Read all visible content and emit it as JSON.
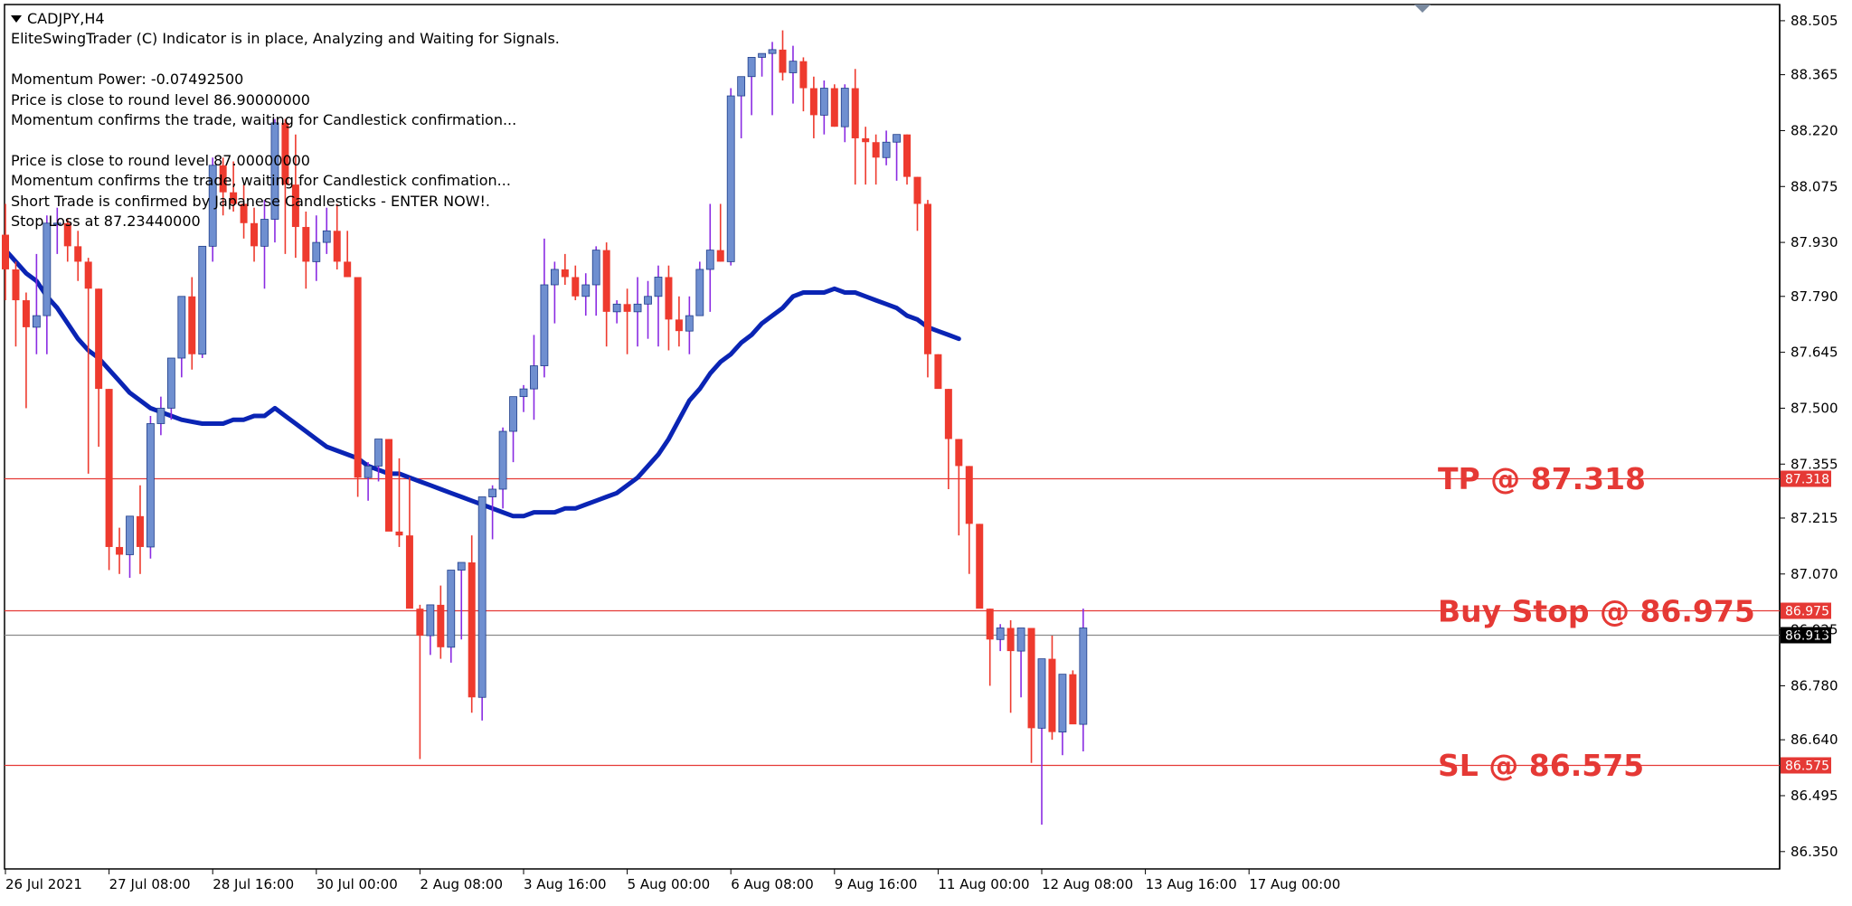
{
  "header": {
    "symbol": "CADJPY,H4",
    "lines": [
      "EliteSwingTrader (C) Indicator is in place, Analyzing and Waiting for Signals.",
      "",
      "Momentum Power: -0.07492500",
      "Price is close to round level 86.90000000",
      "Momentum confirms the trade, waiting for Candlestick confirmation...",
      "",
      "Price is close to round level 87.00000000",
      "Momentum confirms the trade, waiting for Candlestick confimation...",
      "Short Trade is confirmed by Japanese Candlesticks - ENTER NOW!.",
      "Stop Loss at 87.23440000"
    ]
  },
  "chart_data": {
    "type": "candlestick",
    "ylim": [
      86.305,
      88.547
    ],
    "y_ticks": [
      "88.505",
      "88.365",
      "88.220",
      "88.075",
      "87.930",
      "87.790",
      "87.645",
      "87.500",
      "87.355",
      "87.215",
      "87.070",
      "86.925",
      "86.780",
      "86.640",
      "86.495",
      "86.350"
    ],
    "x_ticks": [
      "26 Jul 2021",
      "27 Jul 08:00",
      "28 Jul 16:00",
      "30 Jul 00:00",
      "2 Aug 08:00",
      "3 Aug 16:00",
      "5 Aug 00:00",
      "6 Aug 08:00",
      "9 Aug 16:00",
      "11 Aug 00:00",
      "12 Aug 08:00",
      "13 Aug 16:00",
      "17 Aug 00:00"
    ],
    "colors": {
      "bull": "#6f8fd0",
      "bear": "#ee3a2e",
      "wick_bull": "#8a2be2",
      "wick_bear": "#ee3a2e",
      "ma": "#0a24b4",
      "level": "#e53935",
      "current": "#8a8a8a",
      "annotation": "#e53935"
    },
    "candles": [
      [
        87.95,
        88.03,
        87.78,
        87.86
      ],
      [
        87.86,
        87.88,
        87.66,
        87.78
      ],
      [
        87.78,
        87.8,
        87.5,
        87.71
      ],
      [
        87.71,
        87.9,
        87.64,
        87.74
      ],
      [
        87.74,
        88.0,
        87.64,
        87.98
      ],
      [
        87.98,
        88.02,
        87.9,
        87.98
      ],
      [
        87.98,
        87.99,
        87.88,
        87.92
      ],
      [
        87.92,
        87.96,
        87.83,
        87.88
      ],
      [
        87.88,
        87.89,
        87.33,
        87.81
      ],
      [
        87.81,
        87.81,
        87.4,
        87.55
      ],
      [
        87.55,
        87.55,
        87.08,
        87.14
      ],
      [
        87.14,
        87.19,
        87.07,
        87.12
      ],
      [
        87.12,
        87.21,
        87.06,
        87.22
      ],
      [
        87.22,
        87.3,
        87.07,
        87.14
      ],
      [
        87.14,
        87.48,
        87.11,
        87.46
      ],
      [
        87.46,
        87.53,
        87.43,
        87.5
      ],
      [
        87.5,
        87.63,
        87.47,
        87.63
      ],
      [
        87.63,
        87.77,
        87.58,
        87.79
      ],
      [
        87.79,
        87.84,
        87.6,
        87.64
      ],
      [
        87.64,
        87.9,
        87.63,
        87.92
      ],
      [
        87.92,
        88.15,
        87.88,
        88.13
      ],
      [
        88.13,
        88.15,
        88.0,
        88.06
      ],
      [
        88.06,
        88.14,
        88.01,
        88.03
      ],
      [
        88.03,
        88.08,
        87.94,
        87.98
      ],
      [
        87.98,
        88.02,
        87.88,
        87.92
      ],
      [
        87.92,
        88.04,
        87.81,
        87.99
      ],
      [
        87.99,
        88.25,
        87.93,
        88.24
      ],
      [
        88.24,
        88.25,
        87.9,
        88.08
      ],
      [
        88.08,
        88.21,
        87.89,
        87.97
      ],
      [
        87.97,
        88.01,
        87.81,
        87.88
      ],
      [
        87.88,
        88.0,
        87.83,
        87.93
      ],
      [
        87.93,
        88.02,
        87.9,
        87.96
      ],
      [
        87.96,
        88.03,
        87.86,
        87.88
      ],
      [
        87.88,
        87.96,
        87.84,
        87.84
      ],
      [
        87.84,
        87.84,
        87.27,
        87.32
      ],
      [
        87.32,
        87.36,
        87.26,
        87.35
      ],
      [
        87.35,
        87.39,
        87.31,
        87.42
      ],
      [
        87.42,
        87.42,
        87.34,
        87.18
      ],
      [
        87.18,
        87.37,
        87.14,
        87.17
      ],
      [
        87.17,
        87.32,
        87.03,
        86.98
      ],
      [
        86.98,
        86.99,
        86.59,
        86.91
      ],
      [
        86.91,
        86.97,
        86.86,
        86.99
      ],
      [
        86.99,
        87.04,
        86.85,
        86.88
      ],
      [
        86.88,
        87.02,
        86.84,
        87.08
      ],
      [
        87.08,
        87.08,
        86.9,
        87.1
      ],
      [
        87.1,
        87.17,
        86.71,
        86.75
      ],
      [
        86.75,
        87.22,
        86.69,
        87.27
      ],
      [
        87.27,
        87.3,
        87.16,
        87.29
      ],
      [
        87.29,
        87.45,
        87.24,
        87.44
      ],
      [
        87.44,
        87.53,
        87.36,
        87.53
      ],
      [
        87.53,
        87.56,
        87.49,
        87.55
      ],
      [
        87.55,
        87.69,
        87.47,
        87.61
      ],
      [
        87.61,
        87.94,
        87.58,
        87.82
      ],
      [
        87.82,
        87.88,
        87.72,
        87.86
      ],
      [
        87.86,
        87.9,
        87.82,
        87.84
      ],
      [
        87.84,
        87.87,
        87.78,
        87.79
      ],
      [
        87.79,
        87.85,
        87.74,
        87.82
      ],
      [
        87.82,
        87.92,
        87.74,
        87.91
      ],
      [
        87.91,
        87.93,
        87.66,
        87.75
      ],
      [
        87.75,
        87.78,
        87.72,
        87.77
      ],
      [
        87.77,
        87.81,
        87.64,
        87.75
      ],
      [
        87.75,
        87.84,
        87.66,
        87.77
      ],
      [
        87.77,
        87.83,
        87.68,
        87.79
      ],
      [
        87.79,
        87.87,
        87.66,
        87.84
      ],
      [
        87.84,
        87.87,
        87.65,
        87.73
      ],
      [
        87.73,
        87.79,
        87.66,
        87.7
      ],
      [
        87.7,
        87.79,
        87.64,
        87.74
      ],
      [
        87.74,
        87.88,
        87.74,
        87.86
      ],
      [
        87.86,
        88.03,
        87.75,
        87.91
      ],
      [
        87.91,
        88.03,
        87.88,
        87.88
      ],
      [
        87.88,
        88.33,
        87.87,
        88.31
      ],
      [
        88.31,
        88.34,
        88.2,
        88.36
      ],
      [
        88.36,
        88.4,
        88.26,
        88.41
      ],
      [
        88.41,
        88.42,
        88.36,
        88.42
      ],
      [
        88.42,
        88.45,
        88.26,
        88.43
      ],
      [
        88.43,
        88.48,
        88.35,
        88.37
      ],
      [
        88.37,
        88.44,
        88.29,
        88.4
      ],
      [
        88.4,
        88.41,
        88.27,
        88.33
      ],
      [
        88.33,
        88.36,
        88.2,
        88.26
      ],
      [
        88.26,
        88.35,
        88.21,
        88.33
      ],
      [
        88.33,
        88.34,
        88.23,
        88.23
      ],
      [
        88.23,
        88.34,
        88.19,
        88.33
      ],
      [
        88.33,
        88.38,
        88.08,
        88.2
      ],
      [
        88.2,
        88.23,
        88.08,
        88.19
      ],
      [
        88.19,
        88.21,
        88.08,
        88.15
      ],
      [
        88.15,
        88.22,
        88.13,
        88.19
      ],
      [
        88.19,
        88.2,
        88.09,
        88.21
      ],
      [
        88.21,
        88.21,
        88.08,
        88.1
      ],
      [
        88.1,
        88.1,
        87.96,
        88.03
      ],
      [
        88.03,
        88.04,
        87.58,
        87.64
      ],
      [
        87.64,
        87.64,
        87.58,
        87.55
      ],
      [
        87.55,
        87.55,
        87.29,
        87.42
      ],
      [
        87.42,
        87.42,
        87.17,
        87.35
      ],
      [
        87.35,
        87.35,
        87.07,
        87.2
      ],
      [
        87.2,
        87.2,
        87.04,
        86.98
      ],
      [
        86.98,
        86.98,
        86.78,
        86.9
      ],
      [
        86.9,
        86.94,
        86.87,
        86.93
      ],
      [
        86.93,
        86.95,
        86.71,
        86.87
      ],
      [
        86.87,
        86.93,
        86.75,
        86.93
      ],
      [
        86.93,
        86.93,
        86.58,
        86.67
      ],
      [
        86.67,
        86.84,
        86.42,
        86.85
      ],
      [
        86.85,
        86.91,
        86.64,
        86.66
      ],
      [
        86.66,
        86.78,
        86.6,
        86.81
      ],
      [
        86.81,
        86.82,
        86.69,
        86.68
      ],
      [
        86.68,
        86.98,
        86.61,
        86.93
      ]
    ],
    "moving_average": [
      87.91,
      87.88,
      87.85,
      87.83,
      87.79,
      87.76,
      87.72,
      87.68,
      87.65,
      87.63,
      87.6,
      87.57,
      87.54,
      87.52,
      87.5,
      87.49,
      87.48,
      87.47,
      87.465,
      87.46,
      87.46,
      87.46,
      87.47,
      87.47,
      87.48,
      87.48,
      87.5,
      87.48,
      87.46,
      87.44,
      87.42,
      87.4,
      87.39,
      87.38,
      87.37,
      87.35,
      87.34,
      87.33,
      87.33,
      87.32,
      87.31,
      87.3,
      87.29,
      87.28,
      87.27,
      87.26,
      87.25,
      87.24,
      87.23,
      87.22,
      87.22,
      87.23,
      87.23,
      87.23,
      87.24,
      87.24,
      87.25,
      87.26,
      87.27,
      87.28,
      87.3,
      87.32,
      87.35,
      87.38,
      87.42,
      87.47,
      87.52,
      87.55,
      87.59,
      87.62,
      87.64,
      87.67,
      87.69,
      87.72,
      87.74,
      87.76,
      87.79,
      87.8,
      87.8,
      87.8,
      87.81,
      87.8,
      87.8,
      87.79,
      87.78,
      87.77,
      87.76,
      87.74,
      87.73,
      87.71,
      87.7,
      87.69,
      87.68
    ],
    "levels": [
      {
        "price": 87.318,
        "label": "87.318",
        "annotation": "TP @ 87.318"
      },
      {
        "price": 86.975,
        "label": "86.975",
        "annotation": "Buy Stop @ 86.975"
      },
      {
        "price": 86.575,
        "label": "86.575",
        "annotation": "SL @ 86.575"
      }
    ],
    "current_price": {
      "price": 86.913,
      "label": "86.913"
    }
  }
}
